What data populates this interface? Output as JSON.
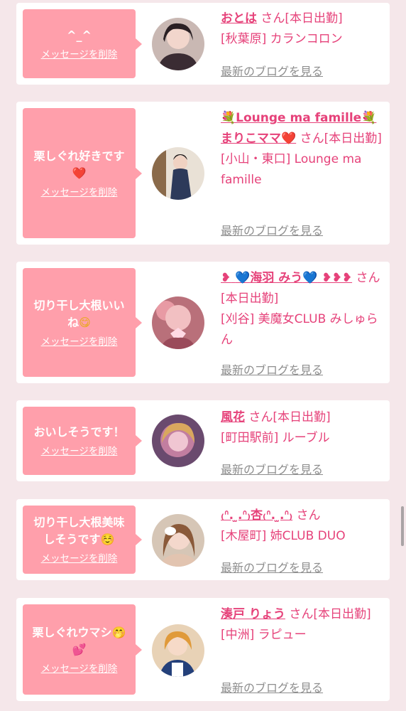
{
  "delete_label": "メッセージを削除",
  "blog_label": "最新のブログを見る",
  "san": "さん",
  "status": "[本日出勤]",
  "items": [
    {
      "message": "^_^",
      "name": "おとは",
      "shop": "[秋葉原] カランコロン"
    },
    {
      "message": "栗しぐれ好きです",
      "message_emoji": "❤️",
      "name_prefix": "💐Lounge ma famille💐",
      "name": "まりこママ",
      "name_emoji": "❤️",
      "shop": "[小山・東口] Lounge ma famille"
    },
    {
      "message": "切り干し大根いいね",
      "message_emoji": "😋",
      "name_lead": "❥",
      "name_heart_a": "💙",
      "name": "海羽 みう",
      "name_heart_b": "💙",
      "name_tail": "❥❥❥",
      "shop": "[刈谷] 美魔女CLUB みしゅらん"
    },
    {
      "message": "おいしそうです！",
      "name": "風花",
      "shop": "[町田駅前] ルーブル"
    },
    {
      "message": "切り干し大根美味しそうです",
      "message_emoji": "☺️",
      "name": "₍ᐢ. ̫.ᐢ₎杏₍ᐢ. ̫.ᐢ₎",
      "shop": "[木屋町] 姉CLUB DUO"
    },
    {
      "message": "栗しぐれウマシ",
      "message_emoji": "🤭",
      "message_emoji2": "💕",
      "name": "湊戸 りょう",
      "shop": "[中洲] ラピュー"
    }
  ]
}
